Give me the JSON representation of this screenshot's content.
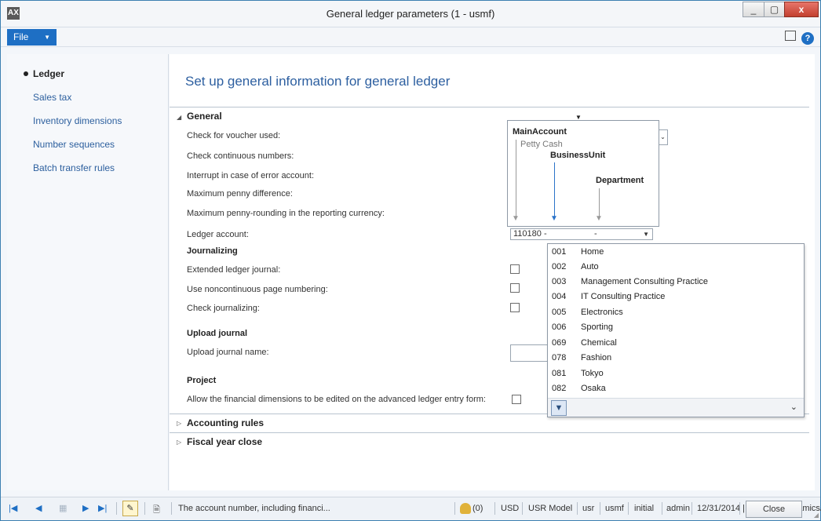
{
  "window": {
    "title": "General ledger parameters (1 - usmf)",
    "app_icon": "AX",
    "minimize_glyph": "_",
    "maximize_glyph": "▢",
    "close_glyph": "x"
  },
  "menu": {
    "file_label": "File",
    "layout_icon": "layout-icon",
    "help_icon": "help-icon"
  },
  "nav": {
    "items": [
      {
        "label": "Ledger",
        "active": true
      },
      {
        "label": "Sales tax"
      },
      {
        "label": "Inventory dimensions"
      },
      {
        "label": "Number sequences"
      },
      {
        "label": "Batch transfer rules"
      }
    ]
  },
  "main": {
    "heading": "Set up general information for general ledger",
    "general": {
      "title": "General",
      "labels": {
        "check_voucher": "Check for voucher used:",
        "check_continuous": "Check continuous numbers:",
        "interrupt": "Interrupt in case of error account:",
        "max_penny": "Maximum penny difference:",
        "max_penny_rounding": "Maximum penny-rounding in the reporting currency:",
        "ledger_account": "Ledger account:"
      },
      "journalizing": {
        "title": "Journalizing",
        "extended": "Extended ledger journal:",
        "noncontinuous": "Use noncontinuous page numbering:",
        "check_journalizing": "Check journalizing:"
      },
      "upload": {
        "title": "Upload journal",
        "name_label": "Upload journal name:"
      },
      "project": {
        "title": "Project",
        "allow_label": "Allow the financial dimensions to be edited on the advanced ledger entry form:"
      }
    },
    "accounting_rules": "Accounting rules",
    "fiscal_year_close": "Fiscal year close"
  },
  "ledger_account_field": {
    "segment_main": "110180 -",
    "segment_bu": "",
    "segment_dept": "-"
  },
  "segment_hint": {
    "main_account": "MainAccount",
    "main_account_value": "Petty Cash",
    "business_unit": "BusinessUnit",
    "department": "Department"
  },
  "lookup": {
    "rows": [
      {
        "code": "001",
        "name": "Home"
      },
      {
        "code": "002",
        "name": "Auto"
      },
      {
        "code": "003",
        "name": "Management Consulting Practice"
      },
      {
        "code": "004",
        "name": "IT Consulting Practice"
      },
      {
        "code": "005",
        "name": "Electronics"
      },
      {
        "code": "006",
        "name": "Sporting"
      },
      {
        "code": "069",
        "name": "Chemical"
      },
      {
        "code": "078",
        "name": "Fashion"
      },
      {
        "code": "081",
        "name": "Tokyo"
      },
      {
        "code": "082",
        "name": "Osaka"
      }
    ],
    "filter_icon": "filter-icon",
    "chevron": "⌄"
  },
  "statusbar": {
    "message": "The account number, including financi...",
    "notifications": "(0)",
    "currency": "USD",
    "model": "USR Model",
    "layer": "usr",
    "company": "usmf",
    "partition": "initial",
    "user": "admin",
    "date": "12/31/2014",
    "app": "MicrosoftDynamicsAX",
    "close_label": "Close"
  }
}
